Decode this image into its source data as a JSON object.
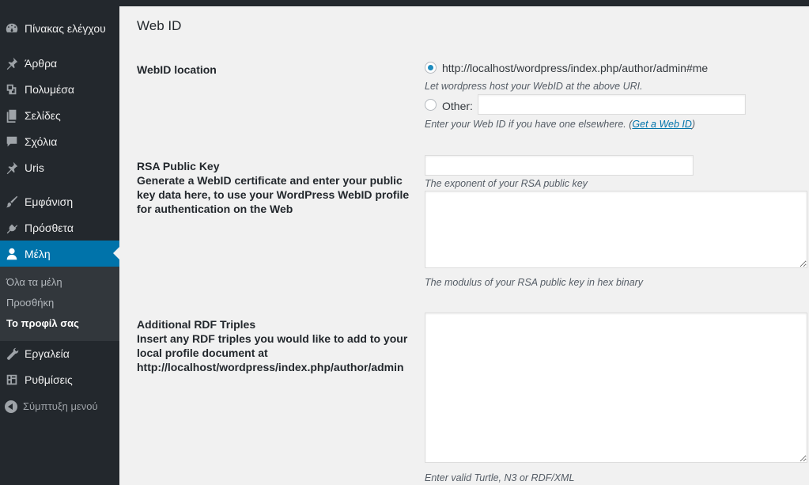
{
  "sidebar": {
    "items": [
      {
        "label": "Πίνακας ελέγχου",
        "icon": "dashboard-icon"
      },
      {
        "label": "Άρθρα",
        "icon": "pin-icon"
      },
      {
        "label": "Πολυμέσα",
        "icon": "media-icon"
      },
      {
        "label": "Σελίδες",
        "icon": "pages-icon"
      },
      {
        "label": "Σχόλια",
        "icon": "comments-icon"
      },
      {
        "label": "Uris",
        "icon": "pin-icon"
      },
      {
        "label": "Εμφάνιση",
        "icon": "brush-icon"
      },
      {
        "label": "Πρόσθετα",
        "icon": "plugin-icon"
      },
      {
        "label": "Μέλη",
        "icon": "users-icon",
        "active": true
      },
      {
        "label": "Εργαλεία",
        "icon": "wrench-icon"
      },
      {
        "label": "Ρυθμίσεις",
        "icon": "settings-icon"
      }
    ],
    "submenu": [
      {
        "label": "Όλα τα μέλη"
      },
      {
        "label": "Προσθήκη"
      },
      {
        "label": "Το προφίλ σας",
        "current": true
      }
    ],
    "collapse_label": "Σύμπτυξη μενού"
  },
  "content": {
    "section_title": "Web ID",
    "webid_location": {
      "label": "WebID location",
      "option_default_value": "http://localhost/wordpress/index.php/author/admin#me",
      "option_default_checked": true,
      "default_hint": "Let wordpress host your WebID at the above URI.",
      "option_other_label": "Other:",
      "other_value": "",
      "other_hint_prefix": "Enter your Web ID if you have one elsewhere. (",
      "other_hint_link": "Get a Web ID",
      "other_hint_suffix": ")"
    },
    "rsa": {
      "label": "RSA Public Key",
      "description": "Generate a WebID certificate and enter your public key data here, to use your WordPress WebID profile for authentication on the Web",
      "exponent_value": "",
      "exponent_hint": "The exponent of your RSA public key",
      "modulus_value": "",
      "modulus_hint": "The modulus of your RSA public key in hex binary"
    },
    "rdf": {
      "label": "Additional RDF Triples",
      "description": "Insert any RDF triples you would like to add to your local profile document at http://localhost/wordpress/index.php/author/admin",
      "value": "",
      "hint": "Enter valid Turtle, N3 or RDF/XML"
    }
  },
  "colors": {
    "sidebar_bg": "#23282d",
    "active_bg": "#0073aa",
    "content_bg": "#f1f1f1",
    "link": "#0073aa"
  }
}
